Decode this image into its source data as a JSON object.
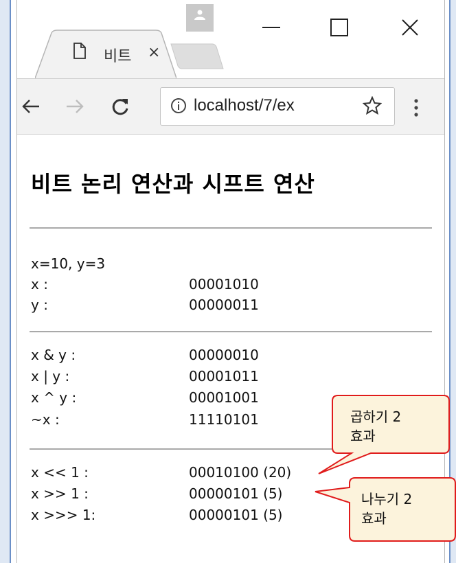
{
  "window": {
    "tab_title": "비트",
    "tab_close": "×",
    "url": "localhost/7/ex"
  },
  "page": {
    "heading": "비트 논리 연산과 시프트 연산",
    "init": "x=10, y=3",
    "values": [
      {
        "label": "x :",
        "value": "00001010"
      },
      {
        "label": "y :",
        "value": "00000011"
      }
    ],
    "logic_ops": [
      {
        "label": "x & y  :",
        "value": "00000010"
      },
      {
        "label": "x | y  :",
        "value": "00001011"
      },
      {
        "label": "x ^ y  :",
        "value": "00001001"
      },
      {
        "label": "~x     :",
        "value": "11110101"
      }
    ],
    "shift_ops": [
      {
        "label": "x << 1 :",
        "value": "00010100 (20)"
      },
      {
        "label": "x >> 1 :",
        "value": "00000101 (5)"
      },
      {
        "label": "x >>> 1:",
        "value": "00000101 (5)"
      }
    ]
  },
  "callouts": {
    "multiply": {
      "line1": "곱하기 2",
      "line2": "효과"
    },
    "divide": {
      "line1": "나누기 2",
      "line2": "효과"
    },
    "fill": "#fcf3dc",
    "stroke": "#e01b1b"
  }
}
